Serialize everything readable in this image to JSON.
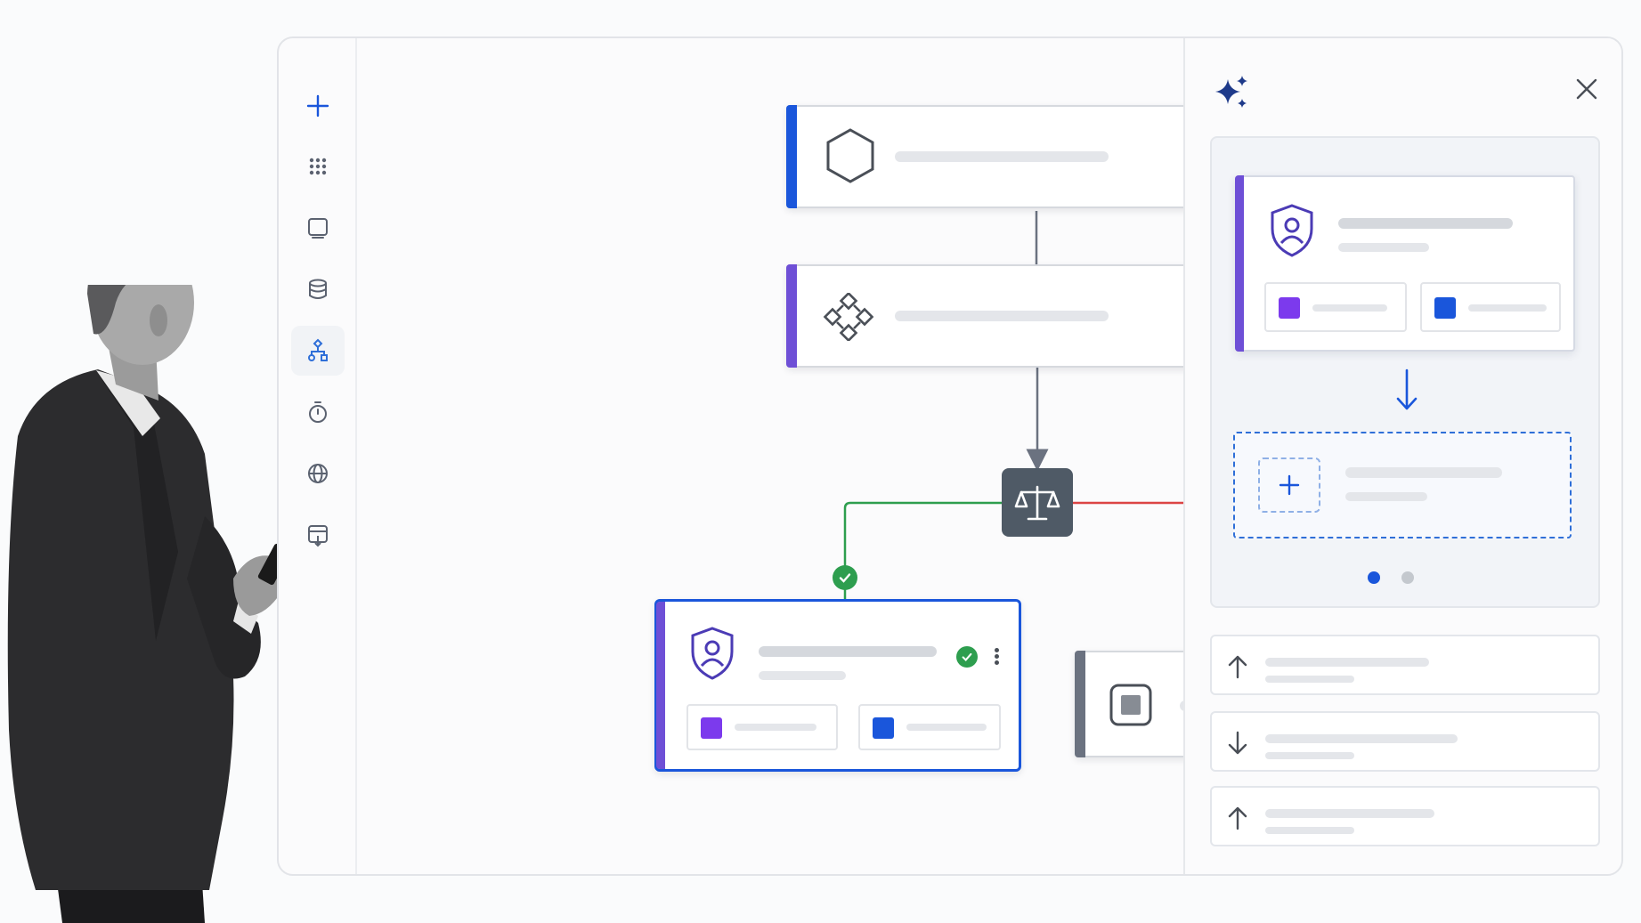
{
  "colors": {
    "brand_blue": "#1a56db",
    "accent_blue": "#2f6fd8",
    "accent_purple": "#6e4fd6",
    "accent_gray": "#6b7280",
    "success_green": "#2e9e4f",
    "error_red": "#dc4545",
    "decision_slate": "#4f5a66"
  },
  "rail": {
    "items": [
      {
        "icon": "plus-icon"
      },
      {
        "icon": "apps-grid-icon"
      },
      {
        "icon": "monitor-icon"
      },
      {
        "icon": "database-icon"
      },
      {
        "icon": "workflow-icon",
        "active": true
      },
      {
        "icon": "timer-icon"
      },
      {
        "icon": "globe-icon"
      },
      {
        "icon": "form-icon"
      }
    ]
  },
  "canvas": {
    "nodes": [
      {
        "icon": "hexagon-icon",
        "status": "success",
        "accent": "blue"
      },
      {
        "icon": "network-icon",
        "status": "success",
        "accent": "purple"
      },
      {
        "icon": "scale-icon",
        "type": "decision"
      },
      {
        "icon": "shield-user-icon",
        "status": "success",
        "accent": "purple",
        "selected": true
      },
      {
        "icon": "stop-icon",
        "status": "success",
        "accent": "gray"
      }
    ],
    "branches": [
      {
        "outcome": "approved",
        "icon": "check-icon",
        "color": "green"
      },
      {
        "outcome": "rejected",
        "icon": "x-icon",
        "color": "red"
      }
    ]
  },
  "assistant_panel": {
    "icon": "sparkle-icon",
    "preview_icon": "shield-user-icon",
    "carousel": {
      "count": 2,
      "active": 0
    },
    "suggestions": [
      {
        "icon": "arrow-up-icon"
      },
      {
        "icon": "arrow-down-icon"
      },
      {
        "icon": "arrow-up-icon"
      }
    ]
  }
}
